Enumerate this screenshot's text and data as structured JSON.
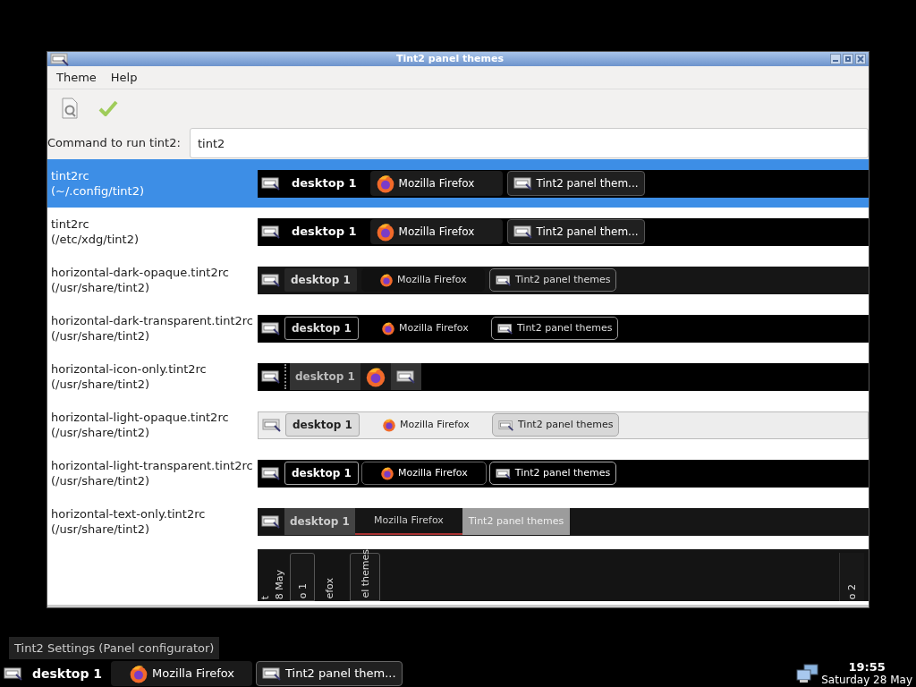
{
  "window": {
    "title": "Tint2 panel themes"
  },
  "menu": [
    "Theme",
    "Help"
  ],
  "command": {
    "label": "Command to run tint2:",
    "value": "tint2"
  },
  "themes": [
    {
      "name": "tint2rc",
      "path": "(~/.config/tint2)",
      "selected": true,
      "preview": {
        "kind": "default",
        "desktop": "desktop 1",
        "tasks": [
          {
            "kind": "firefox",
            "label": "Mozilla Firefox",
            "selected": false
          },
          {
            "kind": "tint2",
            "label": "Tint2 panel them...",
            "selected": true
          }
        ]
      }
    },
    {
      "name": "tint2rc",
      "path": "(/etc/xdg/tint2)",
      "selected": false,
      "preview": {
        "kind": "default",
        "desktop": "desktop 1",
        "tasks": [
          {
            "kind": "firefox",
            "label": "Mozilla Firefox",
            "selected": false
          },
          {
            "kind": "tint2",
            "label": "Tint2 panel them...",
            "selected": true
          }
        ]
      }
    },
    {
      "name": "horizontal-dark-opaque.tint2rc",
      "path": "(/usr/share/tint2)",
      "selected": false,
      "preview": {
        "kind": "dark-opaque",
        "desktop": "desktop 1",
        "tasks": [
          {
            "kind": "firefox",
            "label": "Mozilla Firefox",
            "selected": false
          },
          {
            "kind": "tint2",
            "label": "Tint2 panel themes",
            "selected": true
          }
        ]
      }
    },
    {
      "name": "horizontal-dark-transparent.tint2rc",
      "path": "(/usr/share/tint2)",
      "selected": false,
      "preview": {
        "kind": "dark-transparent",
        "desktop": "desktop 1",
        "tasks": [
          {
            "kind": "firefox",
            "label": "Mozilla Firefox",
            "selected": false
          },
          {
            "kind": "tint2",
            "label": "Tint2 panel themes",
            "selected": true
          }
        ]
      }
    },
    {
      "name": "horizontal-icon-only.tint2rc",
      "path": "(/usr/share/tint2)",
      "selected": false,
      "preview": {
        "kind": "icon-only",
        "desktop": "desktop 1",
        "tasks": [
          {
            "kind": "firefox",
            "selected": false
          },
          {
            "kind": "tint2",
            "selected": true
          }
        ]
      }
    },
    {
      "name": "horizontal-light-opaque.tint2rc",
      "path": "(/usr/share/tint2)",
      "selected": false,
      "preview": {
        "kind": "light-opaque",
        "desktop": "desktop 1",
        "tasks": [
          {
            "kind": "firefox",
            "label": "Mozilla Firefox",
            "selected": false
          },
          {
            "kind": "tint2",
            "label": "Tint2 panel themes",
            "selected": true
          }
        ]
      }
    },
    {
      "name": "horizontal-light-transparent.tint2rc",
      "path": "(/usr/share/tint2)",
      "selected": false,
      "preview": {
        "kind": "light-transparent",
        "desktop": "desktop 1",
        "tasks": [
          {
            "kind": "firefox",
            "label": "Mozilla Firefox",
            "selected": false
          },
          {
            "kind": "tint2",
            "label": "Tint2 panel themes",
            "selected": true
          }
        ]
      }
    },
    {
      "name": "horizontal-text-only.tint2rc",
      "path": "(/usr/share/tint2)",
      "selected": false,
      "preview": {
        "kind": "text-only",
        "desktop": "desktop 1",
        "tasks": [
          {
            "label": "Mozilla Firefox",
            "selected": false
          },
          {
            "label": "Tint2 panel themes",
            "selected": true
          }
        ]
      }
    },
    {
      "selected": false,
      "preview": {
        "kind": "vertical",
        "texts": [
          "t",
          "8 May",
          "o 1",
          "efox",
          "el themes",
          "o 2"
        ]
      }
    }
  ],
  "tooltip": "Tint2 Settings (Panel configurator)",
  "taskbar": {
    "desktop": "desktop 1",
    "tasks": [
      {
        "kind": "firefox",
        "label": "Mozilla Firefox",
        "selected": false
      },
      {
        "kind": "tint2",
        "label": "Tint2 panel them...",
        "selected": true
      }
    ],
    "clock": {
      "time": "19:55",
      "date": "Saturday 28 May"
    }
  }
}
